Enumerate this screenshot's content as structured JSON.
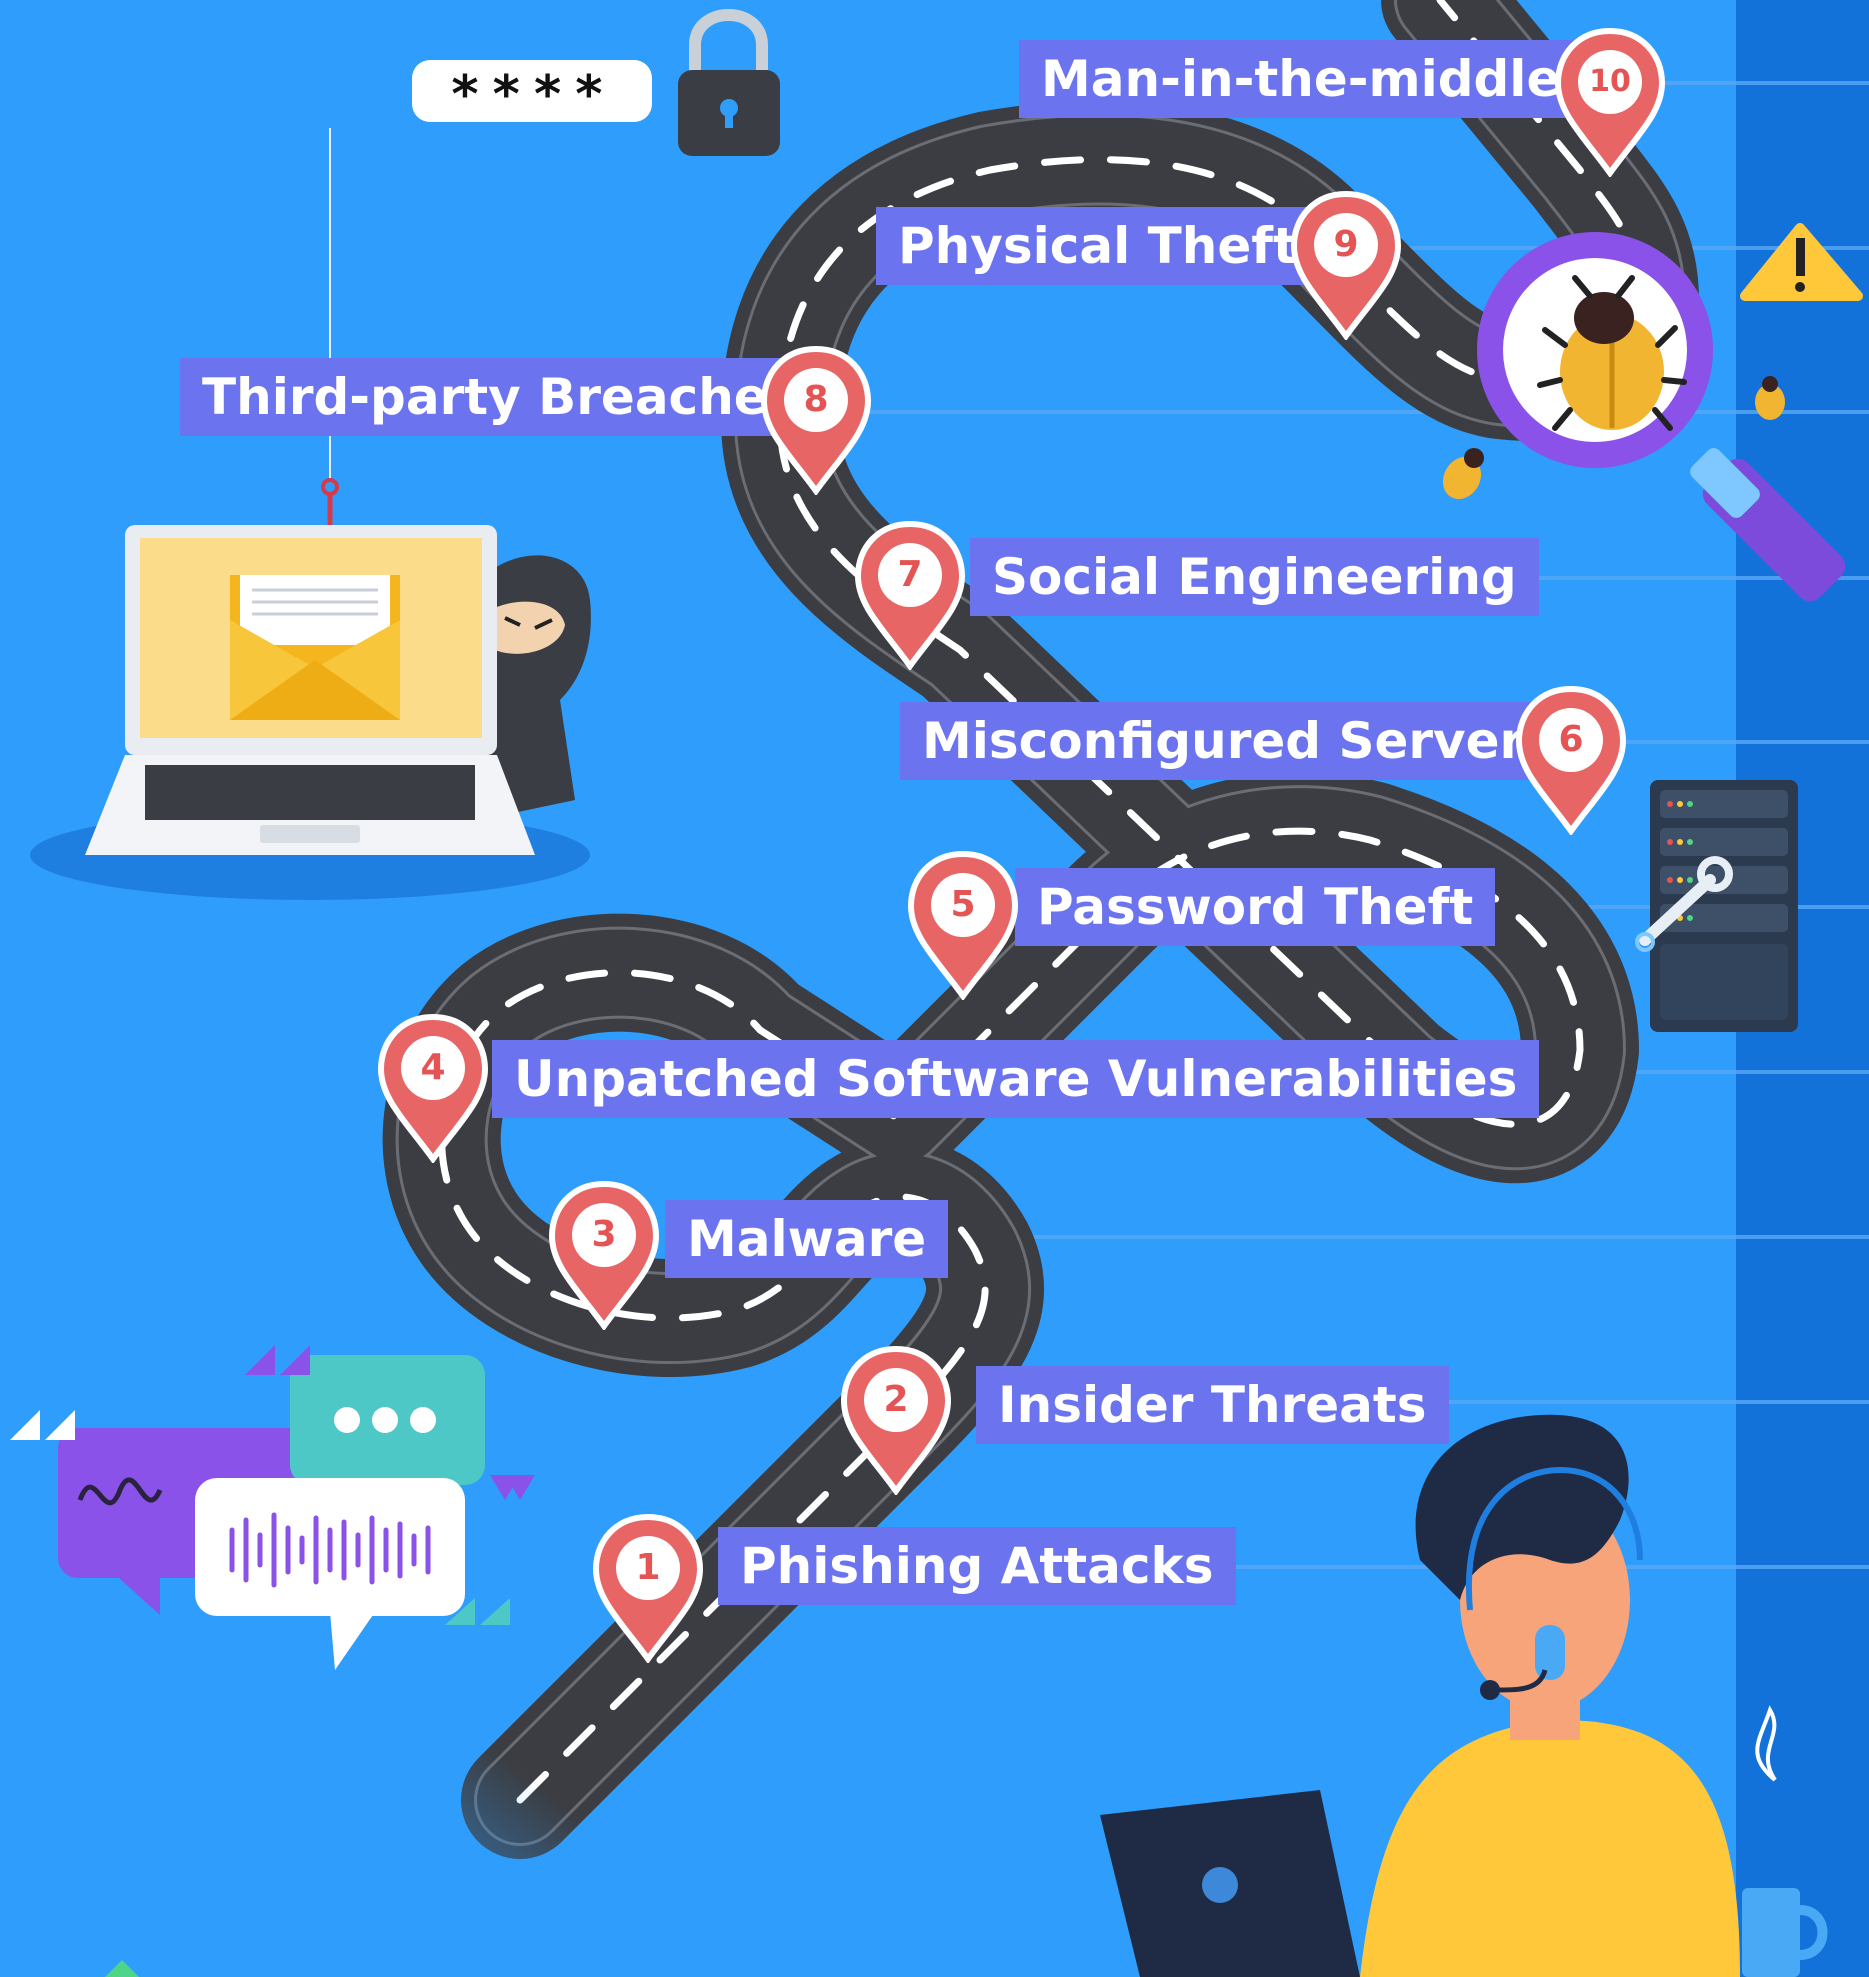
{
  "password_mask": "****",
  "colors": {
    "background": "#2e9dfb",
    "label_fill": "#6c73ef",
    "pin_red": "#e86565",
    "road": "#3b3d42"
  },
  "steps": [
    {
      "n": "1",
      "label": "Phishing Attacks"
    },
    {
      "n": "2",
      "label": "Insider Threats"
    },
    {
      "n": "3",
      "label": "Malware"
    },
    {
      "n": "4",
      "label": "Unpatched Software Vulnerabilities"
    },
    {
      "n": "5",
      "label": "Password Theft"
    },
    {
      "n": "6",
      "label": "Misconfigured Servers"
    },
    {
      "n": "7",
      "label": "Social Engineering"
    },
    {
      "n": "8",
      "label": "Third-party Breaches"
    },
    {
      "n": "9",
      "label": "Physical Theft"
    },
    {
      "n": "10",
      "label": "Man-in-the-middle"
    }
  ],
  "icons": [
    "padlock-icon",
    "warning-icon",
    "bug-icon",
    "magnifier-icon",
    "server-rack-icon",
    "wrench-icon",
    "fish-hook-icon",
    "email-envelope-icon",
    "hacker-icon",
    "laptop-icon",
    "chat-bubbles-icon",
    "support-agent-icon",
    "coffee-mug-icon"
  ]
}
